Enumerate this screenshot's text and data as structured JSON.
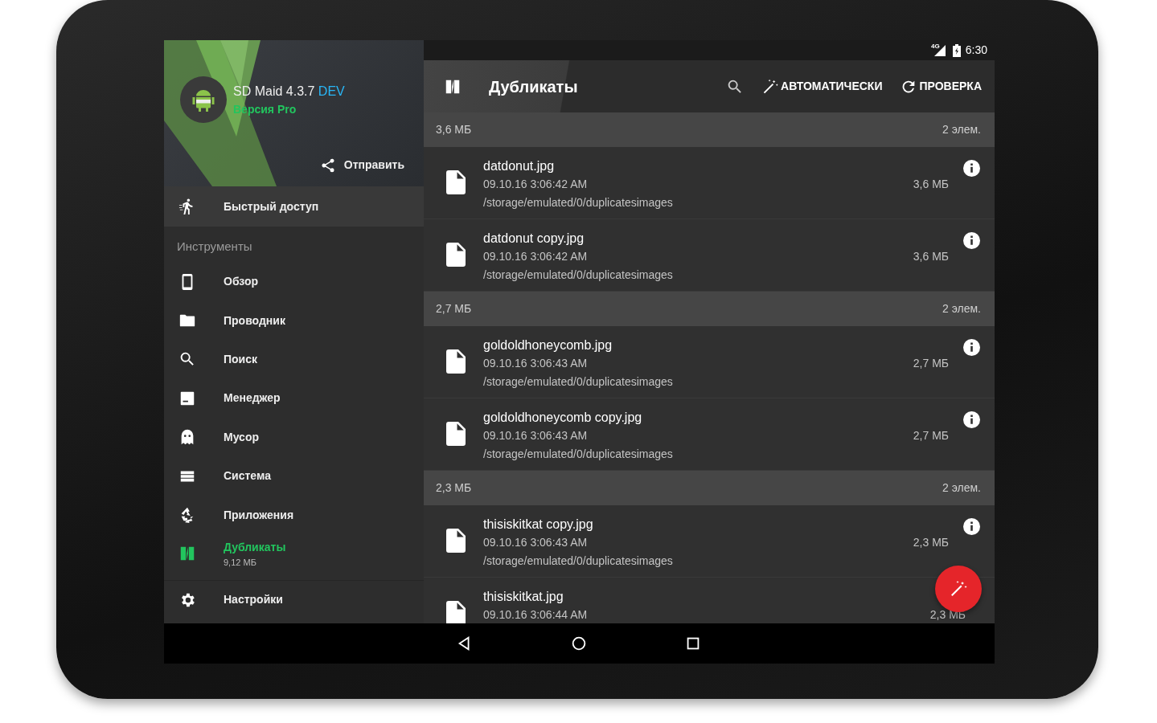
{
  "status_bar": {
    "network": "4G",
    "time": "6:30"
  },
  "drawer": {
    "app_name": "SD Maid 4.3.7",
    "app_tag": "DEV",
    "edition": "Версия Pro",
    "share_button": "Отправить",
    "quick_access": "Быстрый доступ",
    "section_title": "Инструменты",
    "items": [
      {
        "label": "Обзор",
        "kind": "phone",
        "selected": false
      },
      {
        "label": "Проводник",
        "kind": "folder",
        "selected": false
      },
      {
        "label": "Поиск",
        "kind": "search",
        "selected": false
      },
      {
        "label": "Менеджер",
        "kind": "manager",
        "selected": false
      },
      {
        "label": "Мусор",
        "kind": "ghost",
        "selected": false
      },
      {
        "label": "Система",
        "kind": "list",
        "selected": false
      },
      {
        "label": "Приложения",
        "kind": "recycle",
        "selected": false
      },
      {
        "label": "Дубликаты",
        "subtitle": "9,12 МБ",
        "kind": "duplicates",
        "selected": true
      }
    ],
    "settings": "Настройки"
  },
  "toolbar": {
    "title": "Дубликаты",
    "actions": [
      {
        "label": "АВТОМАТИЧЕСКИ",
        "kind": "wand"
      },
      {
        "label": "ПРОВЕРКА",
        "kind": "refresh"
      }
    ]
  },
  "groups": [
    {
      "size": "3,6 МБ",
      "count": "2 элем.",
      "files": [
        {
          "name": "datdonut.jpg",
          "date": "09.10.16 3:06:42 AM",
          "path": "/storage/emulated/0/duplicatesimages",
          "size": "3,6 МБ"
        },
        {
          "name": "datdonut copy.jpg",
          "date": "09.10.16 3:06:42 AM",
          "path": "/storage/emulated/0/duplicatesimages",
          "size": "3,6 МБ"
        }
      ]
    },
    {
      "size": "2,7 МБ",
      "count": "2 элем.",
      "files": [
        {
          "name": "goldoldhoneycomb.jpg",
          "date": "09.10.16 3:06:43 AM",
          "path": "/storage/emulated/0/duplicatesimages",
          "size": "2,7 МБ"
        },
        {
          "name": "goldoldhoneycomb copy.jpg",
          "date": "09.10.16 3:06:43 AM",
          "path": "/storage/emulated/0/duplicatesimages",
          "size": "2,7 МБ"
        }
      ]
    },
    {
      "size": "2,3 МБ",
      "count": "2 элем.",
      "files": [
        {
          "name": "thisiskitkat copy.jpg",
          "date": "09.10.16 3:06:43 AM",
          "path": "/storage/emulated/0/duplicatesimages",
          "size": "2,3 МБ"
        },
        {
          "name": "thisiskitkat.jpg",
          "date": "09.10.16 3:06:44 AM",
          "size": "2,3 МБ"
        }
      ]
    }
  ]
}
